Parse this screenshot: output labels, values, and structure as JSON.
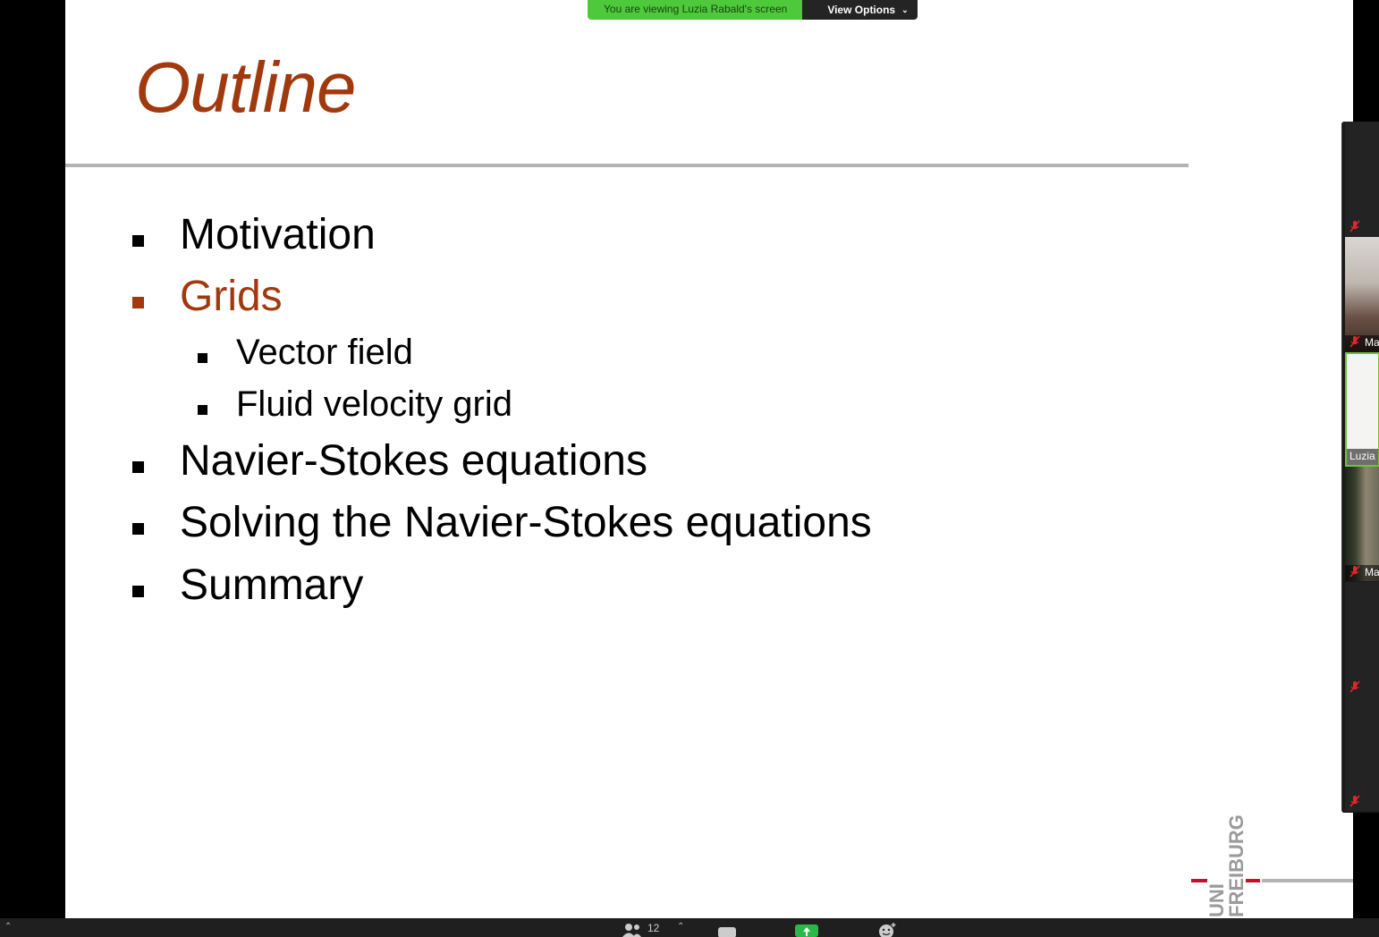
{
  "share_banner": {
    "text": "You are viewing Luzia Rabald's screen",
    "view_options_label": "View Options",
    "accent_color": "#4ec93c"
  },
  "slide": {
    "title": "Outline",
    "title_color": "#a0390e",
    "items": [
      {
        "label": "Motivation",
        "level": 1,
        "active": false
      },
      {
        "label": "Grids",
        "level": 1,
        "active": true
      },
      {
        "label": "Vector field",
        "level": 2,
        "active": false
      },
      {
        "label": "Fluid velocity grid",
        "level": 2,
        "active": false
      },
      {
        "label": "Navier-Stokes equations",
        "level": 1,
        "active": false
      },
      {
        "label": "Solving the Navier-Stokes equations",
        "level": 1,
        "active": false
      },
      {
        "label": "Summary",
        "level": 1,
        "active": false
      }
    ],
    "logo": {
      "line1": "UNI",
      "line2": "FREIBURG",
      "accent_color": "#c8102e"
    }
  },
  "gallery": {
    "tiles": [
      {
        "name": "",
        "muted": true,
        "video": false
      },
      {
        "name": "Ma",
        "muted": true,
        "video": true
      },
      {
        "name": "Luzia",
        "muted": false,
        "video": true,
        "speaking": true
      },
      {
        "name": "Ma",
        "muted": true,
        "video": true
      },
      {
        "name": "",
        "muted": true,
        "video": false
      },
      {
        "name": "",
        "muted": true,
        "video": false
      }
    ]
  },
  "toolbar": {
    "participants_count": "12",
    "share_color": "#2bb84a"
  }
}
